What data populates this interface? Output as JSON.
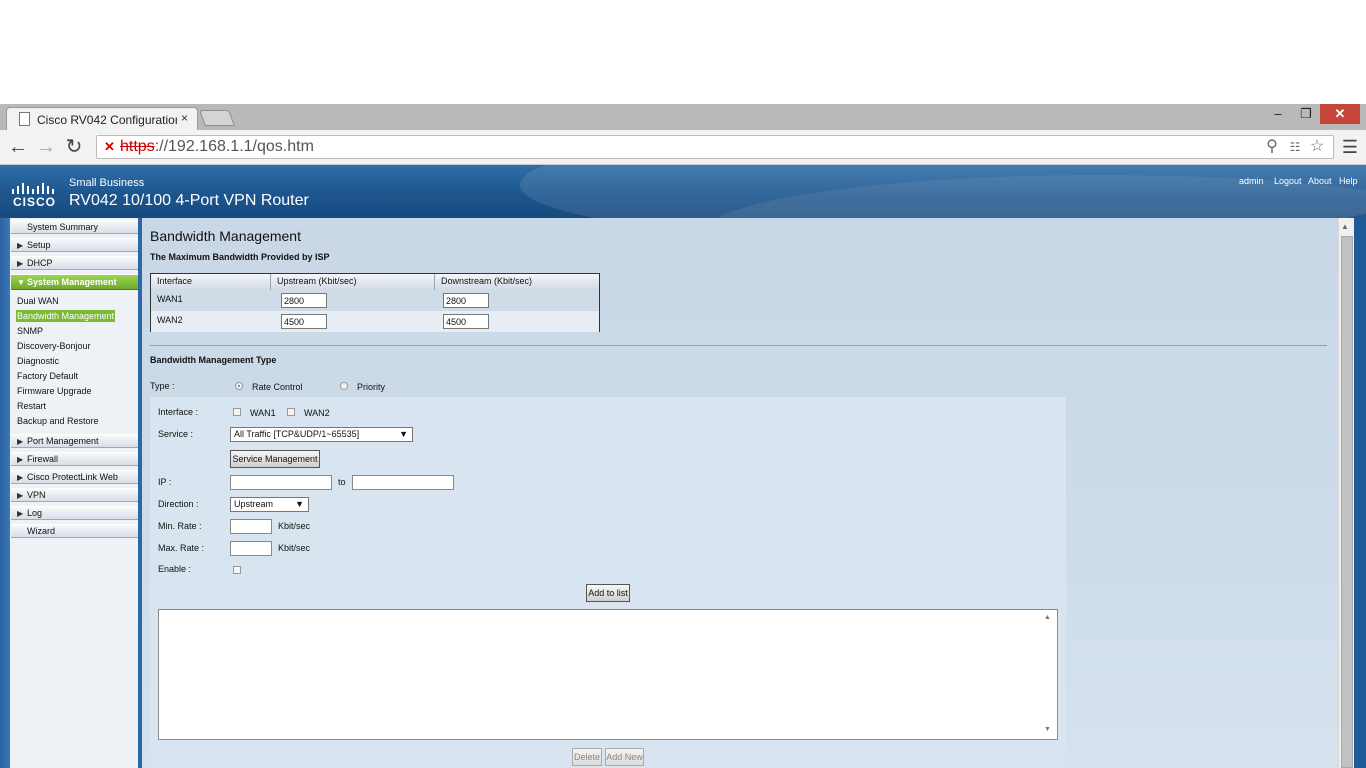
{
  "browser": {
    "tab_title": "Cisco RV042 Configuration",
    "tab_close": "×",
    "url_scheme": "https",
    "url_rest": "://192.168.1.1/qos.htm",
    "window_min": "‒",
    "window_max": "❐",
    "window_close": "✕"
  },
  "header": {
    "brand": "CISCO",
    "small_business": "Small Business",
    "product": "RV042  10/100 4-Port VPN Router",
    "links": {
      "admin": "admin",
      "logout": "Logout",
      "about": "About",
      "help": "Help"
    }
  },
  "sidebar": {
    "items": [
      {
        "label": "System Summary"
      },
      {
        "label": "Setup"
      },
      {
        "label": "DHCP"
      },
      {
        "label": "System Management"
      },
      {
        "label": "Port Management"
      },
      {
        "label": "Firewall"
      },
      {
        "label": "Cisco ProtectLink Web"
      },
      {
        "label": "VPN"
      },
      {
        "label": "Log"
      },
      {
        "label": "Wizard"
      }
    ],
    "sub_items": [
      {
        "label": "Dual WAN"
      },
      {
        "label": "Bandwidth Management"
      },
      {
        "label": "SNMP"
      },
      {
        "label": "Discovery-Bonjour"
      },
      {
        "label": "Diagnostic"
      },
      {
        "label": "Factory Default"
      },
      {
        "label": "Firmware Upgrade"
      },
      {
        "label": "Restart"
      },
      {
        "label": "Backup and Restore"
      }
    ]
  },
  "main": {
    "title": "Bandwidth Management",
    "isp_section": "The Maximum Bandwidth Provided by ISP",
    "table": {
      "headers": [
        "Interface",
        "Upstream (Kbit/sec)",
        "Downstream (Kbit/sec)"
      ],
      "rows": [
        {
          "interface": "WAN1",
          "upstream": "2800",
          "downstream": "2800"
        },
        {
          "interface": "WAN2",
          "upstream": "4500",
          "downstream": "4500"
        }
      ]
    },
    "type_section": "Bandwidth Management Type",
    "type_label": "Type :",
    "type_options": {
      "rate_control": "Rate Control",
      "priority": "Priority"
    },
    "form": {
      "interface_label": "Interface :",
      "wan1": "WAN1",
      "wan2": "WAN2",
      "service_label": "Service :",
      "service_value": "All Traffic [TCP&UDP/1~65535]",
      "service_mgmt_button": "Service Management",
      "ip_label": "IP :",
      "ip_to": "to",
      "direction_label": "Direction :",
      "direction_value": "Upstream",
      "min_rate_label": "Min. Rate :",
      "max_rate_label": "Max. Rate :",
      "unit": "Kbit/sec",
      "enable_label": "Enable :",
      "add_button": "Add to list",
      "delete_button": "Delete",
      "add_new_button": "Add New"
    }
  }
}
